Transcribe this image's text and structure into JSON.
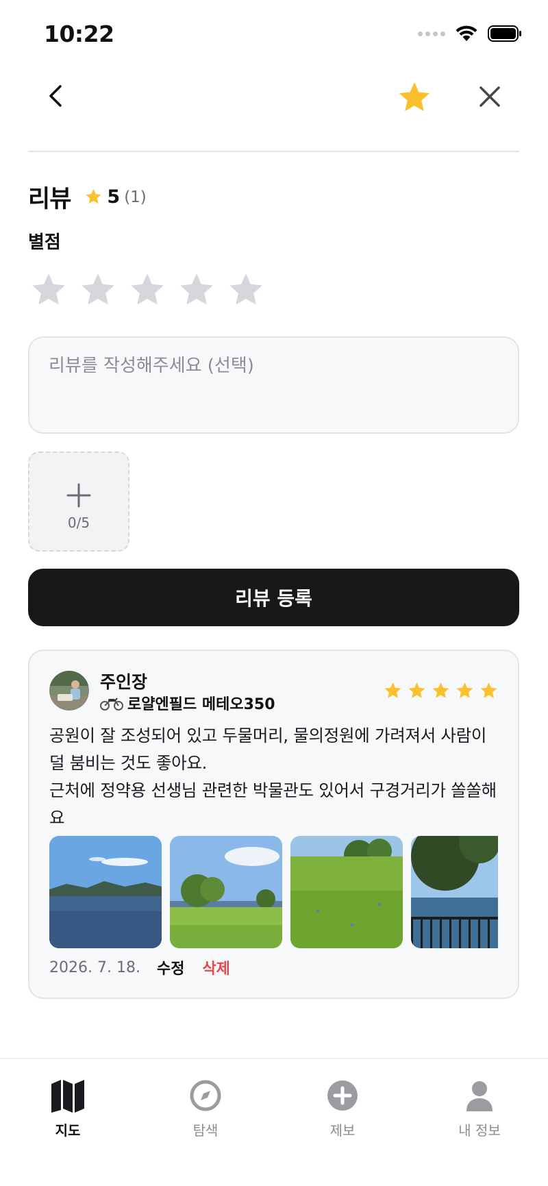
{
  "status_bar": {
    "time": "10:22"
  },
  "header": {
    "favorite_active": true
  },
  "review_section": {
    "title": "리뷰",
    "average": "5",
    "count": "(1)",
    "rating_label": "별점",
    "selected_rating": 0,
    "input_placeholder": "리뷰를 작성해주세요 (선택)",
    "input_value": "",
    "photo_count": "0/5",
    "submit_label": "리뷰 등록"
  },
  "review": {
    "user_name": "주인장",
    "bike": "로얄엔필드 메테오350",
    "rating": 5,
    "text": "공원이 잘 조성되어 있고 두물머리, 물의정원에 가려져서 사람이 덜 붐비는 것도 좋아요.\n근처에 정약용 선생님 관련한 박물관도 있어서 구경거리가 쏠쏠해요",
    "date": "2026. 7. 18.",
    "edit_label": "수정",
    "delete_label": "삭제"
  },
  "tabs": [
    {
      "label": "지도",
      "icon": "map-icon",
      "active": true
    },
    {
      "label": "탐색",
      "icon": "compass-icon",
      "active": false
    },
    {
      "label": "제보",
      "icon": "plus-circle-icon",
      "active": false
    },
    {
      "label": "내 정보",
      "icon": "person-icon",
      "active": false
    }
  ],
  "colors": {
    "accent_star": "#FBC02D",
    "empty_star": "#D5D7DC",
    "primary_button": "#18181B",
    "danger": "#E5484D"
  }
}
